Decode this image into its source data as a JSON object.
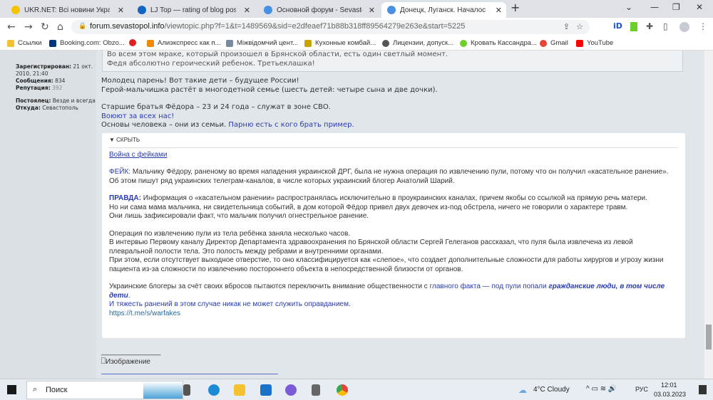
{
  "browser": {
    "tabs": [
      {
        "title": "UKR.NET: Всі новини України, ос",
        "color": "#f5c400"
      },
      {
        "title": "LJ Top — rating of blog posts",
        "color": "#1565c0"
      },
      {
        "title": "Основной форум - Sevastopol.in",
        "color": "#4a90e2"
      },
      {
        "title": "Донецк, Луганск. Началось. - Ст",
        "color": "#4a90e2"
      }
    ],
    "url_host": "forum.sevastopol.info",
    "url_path": "/viewtopic.php?f=1&t=1489569&sid=e2dfeaef71b88b318ff89564279e263e&start=5225",
    "bookmarks": [
      {
        "label": "Ссылки",
        "color": "#f2c230"
      },
      {
        "label": "Booking.com: Obzo...",
        "color": "#003580"
      },
      {
        "label": "",
        "color": "#e02020"
      },
      {
        "label": "Алиэкспресс как п...",
        "color": "#f08a00"
      },
      {
        "label": "Міжвідомчий цент...",
        "color": "#7a8ba0"
      },
      {
        "label": "Кухонные комбай...",
        "color": "#c8a400"
      },
      {
        "label": "Лицензии, допуск...",
        "color": "#555555"
      },
      {
        "label": "Кровать Кассандра...",
        "color": "#6ccf2a"
      },
      {
        "label": "Gmail",
        "color": "#ea4335"
      },
      {
        "label": "YouTube",
        "color": "#ff0000"
      }
    ]
  },
  "profile": {
    "registered_label": "Зарегистрирован:",
    "registered_value": "21 окт. 2010, 21:40",
    "posts_label": "Сообщения:",
    "posts_value": "834",
    "rep_label": "Репутация:",
    "rep_value": "392",
    "resident_label": "Постоялец:",
    "resident_value": "Везде и всегда",
    "from_label": "Откуда:",
    "from_value": "Севастополь"
  },
  "post": {
    "quote_line1": "Во всем этом мраке, который произошел в Брянской области, есть один светлый момент.",
    "quote_line2": "Федя абсолютно героический ребенок. Третьеклашка!",
    "l1": "Молодец парень! Вот такие дети – будущее России!",
    "l2": "Герой-мальчишка растёт в многодетной семье (шесть детей: четыре сына и две дочки).",
    "l3": "Старшие братья Фёдора – 23 и 24 года – служат в зоне СВО.",
    "l4": "Воюют за всех нас!",
    "l5a": "Основы человека – они из семьи.",
    "l5b": "Парню есть с кого брать пример.",
    "spoiler": {
      "toggle": "▼ СКРЫТЬ",
      "link": "Война с фейками",
      "fake_label": "ФЕЙК:",
      "fake_text": "Мальчику Фёдору, раненому во время нападения украинской ДРГ, была не нужна операция по извлечению пули, потому что он получил «касательное ранение».",
      "fake_2": "Об этом пишут ряд украинских телеграм-каналов, в числе которых украинский блогер Анатолий Шарий.",
      "truth_label": "ПРАВДА:",
      "truth_text": "Информация о «касательном ранении» распространялась исключительно в проукраинских каналах, причем якобы со ссылкой на прямую речь матери.",
      "truth_2": "Но ни сама мама мальчика, ни свидетельница событий, в дом которой Фёдор привел двух девочек из-под обстрела, ничего не говорили о характере травм.",
      "truth_3": "Они лишь зафиксировали факт, что мальчик получил огнестрельное ранение.",
      "op_1": "Операция по извлечению пули из тела ребёнка заняла несколько часов.",
      "op_2": "В интервью Первому каналу Директор Департамента здравоохранения по Брянской области Сергей Гелеганов рассказал, что пуля была извлечена из левой плевральной полости тела. Это полость между ребрами и внутренними органами.",
      "op_3": "При этом, если отсутствует выходное отверстие, то оно классифицируется как «слепое», что создает дополнительные сложности для работы хирургов и угрозу жизни пациента из-за сложности по извлечению постороннего объекта в непосредственной близости от органов.",
      "end_1": "Украинские блогеры за счёт своих вбросов пытаются переключить внимание общественности с ",
      "end_1b": "главного факта — под пули попали ",
      "end_1c": "гражданские люди, в том числе дети",
      "end_1d": ".",
      "end_2": "И тяжесть ранений в этом случае никак не может служить оправданием.",
      "url": "https://t.me/s/warfakes"
    },
    "sig_line": "_______________",
    "sig_image_alt": "Изображение"
  },
  "taskbar": {
    "search": "Поиск",
    "weather": "4°C  Cloudy",
    "lang": "РУС",
    "time": "12:01",
    "date": "03.03.2023"
  }
}
